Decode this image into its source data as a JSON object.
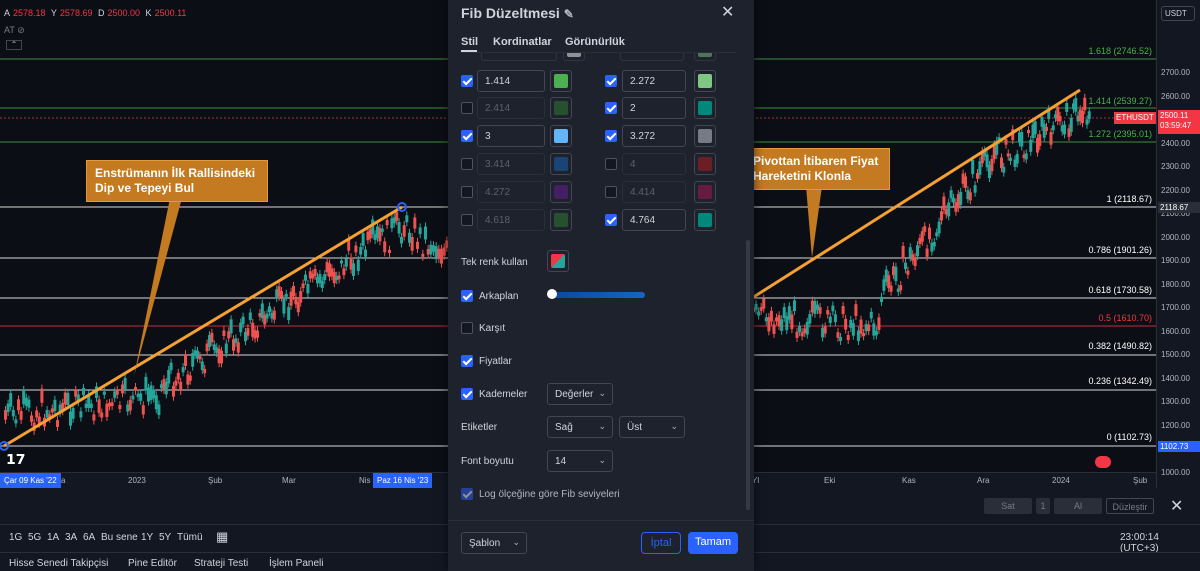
{
  "ohlc": {
    "o_label": "A",
    "o": "2578.18",
    "h_label": "Y",
    "h": "2578.69",
    "l_label": "D",
    "l": "2500.00",
    "c_label": "K",
    "c": "2500.11"
  },
  "at_label": "AT",
  "currency": "USDT",
  "symbol_tag": "ETHUSDT",
  "last_price": "2500.11",
  "countdown": "03:59:47",
  "fib_levels": [
    {
      "label": "1.618 (2746.52)",
      "color": "#4caf50"
    },
    {
      "label": "1.414 (2539.27)",
      "color": "#4caf50"
    },
    {
      "label": "1.272 (2395.01)",
      "color": "#4caf50"
    },
    {
      "label": "1 (2118.67)",
      "color": "#ffffff"
    },
    {
      "label": "0.786 (1901.26)",
      "color": "#ffffff"
    },
    {
      "label": "0.618 (1730.58)",
      "color": "#ffffff"
    },
    {
      "label": "0.5 (1610.70)",
      "color": "#f23645"
    },
    {
      "label": "0.382 (1490.82)",
      "color": "#ffffff"
    },
    {
      "label": "0.236 (1342.49)",
      "color": "#ffffff"
    },
    {
      "label": "0 (1102.73)",
      "color": "#ffffff"
    }
  ],
  "price_ticks": [
    "2700.00",
    "2600.00",
    "2500.00",
    "2400.00",
    "2300.00",
    "2200.00",
    "2100.00",
    "2000.00",
    "1900.00",
    "1800.00",
    "1700.00",
    "1600.00",
    "1500.00",
    "1400.00",
    "1300.00",
    "1200.00",
    "1100.00",
    "1000.00"
  ],
  "price_tags": {
    "one": "2118.67",
    "zero": "1102.73"
  },
  "time_ticks": [
    "a",
    "2023",
    "Şub",
    "Mar",
    "Nis",
    "Yl",
    "Eki",
    "Kas",
    "Ara",
    "2024",
    "Şub"
  ],
  "time_hl": [
    "Çar 09 Kas '22",
    "Paz 16 Nis '23"
  ],
  "callouts": {
    "left": "Enstrümanın İlk Rallisindeki Dip ve Tepeyi Bul",
    "right": "Pivottan İtibaren Fiyat Hareketini Klonla"
  },
  "colors": {
    "accent": "#2962ff",
    "orange": "#f5a033",
    "up": "#26a69a",
    "down": "#ef5350"
  },
  "dialog": {
    "title": "Fib Düzeltmesi",
    "tabs": [
      "Stil",
      "Kordinatlar",
      "Görünürlük"
    ],
    "left_rows": [
      {
        "value": "1.414",
        "checked": true,
        "color": "#4caf50"
      },
      {
        "value": "2.414",
        "checked": false,
        "color": "#2e7d32"
      },
      {
        "value": "3",
        "checked": true,
        "color": "#64b5f6"
      },
      {
        "value": "3.414",
        "checked": false,
        "color": "#1565c0"
      },
      {
        "value": "4.272",
        "checked": false,
        "color": "#6a1b9a"
      },
      {
        "value": "4.618",
        "checked": false,
        "color": "#2e7d32"
      }
    ],
    "right_rows": [
      {
        "value": "2.272",
        "checked": true,
        "color": "#81c784"
      },
      {
        "value": "2",
        "checked": true,
        "color": "#00897b"
      },
      {
        "value": "3.272",
        "checked": true,
        "color": "#787b86"
      },
      {
        "value": "4",
        "checked": false,
        "color": "#b71c1c"
      },
      {
        "value": "4.414",
        "checked": false,
        "color": "#ad1457"
      },
      {
        "value": "4.764",
        "checked": true,
        "color": "#00897b"
      }
    ],
    "single_color": "Tek renk kullan",
    "background": "Arkaplan",
    "reverse": "Karşıt",
    "prices": "Fiyatlar",
    "levels": "Kademeler",
    "levels_value": "Değerler",
    "labels": "Etiketler",
    "labels_h": "Sağ",
    "labels_v": "Üst",
    "font_size_label": "Font boyutu",
    "font_size": "14",
    "log_scale": "Log ölçeğine göre Fib seviyeleri",
    "template": "Şablon",
    "cancel": "İptal",
    "ok": "Tamam"
  },
  "ranges": [
    "1G",
    "5G",
    "1A",
    "3A",
    "6A",
    "Bu sene",
    "1Y",
    "5Y",
    "Tümü"
  ],
  "clock": "23:00:14 (UTC+3)",
  "footer_tabs": [
    "Hisse Senedi Takipçisi",
    "Pine Editör",
    "Strateji Testi",
    "İşlem Paneli"
  ],
  "trade": {
    "sell": "Sat",
    "qty": "1",
    "buy": "Al",
    "edit": "Düzleştir"
  }
}
